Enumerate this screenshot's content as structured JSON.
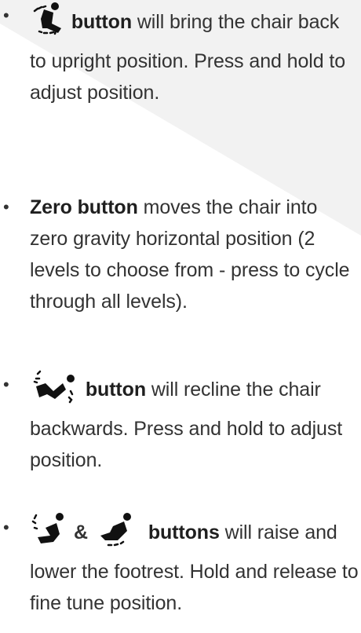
{
  "items": [
    {
      "icon": "upright-seat-icon",
      "bold": "button",
      "rest": " will bring the chair back to upright position. Press and hold to adjust position."
    },
    {
      "bold": "Zero button",
      "rest": " moves the chair into zero gravity horizontal position (2 levels to choose from - press to cycle through all levels)."
    },
    {
      "icon": "recline-seat-icon",
      "bold": "button",
      "rest": " will recline the chair backwards. Press and hold to adjust position."
    },
    {
      "icons": [
        "footrest-raise-icon",
        "footrest-lower-icon"
      ],
      "amp": "&",
      "bold": "buttons",
      "rest": " will raise and lower the footrest. Hold and release to fine tune position."
    }
  ],
  "colors": {
    "text": "#333333",
    "background_band": "#f2f2f2",
    "icon": "#111111"
  }
}
